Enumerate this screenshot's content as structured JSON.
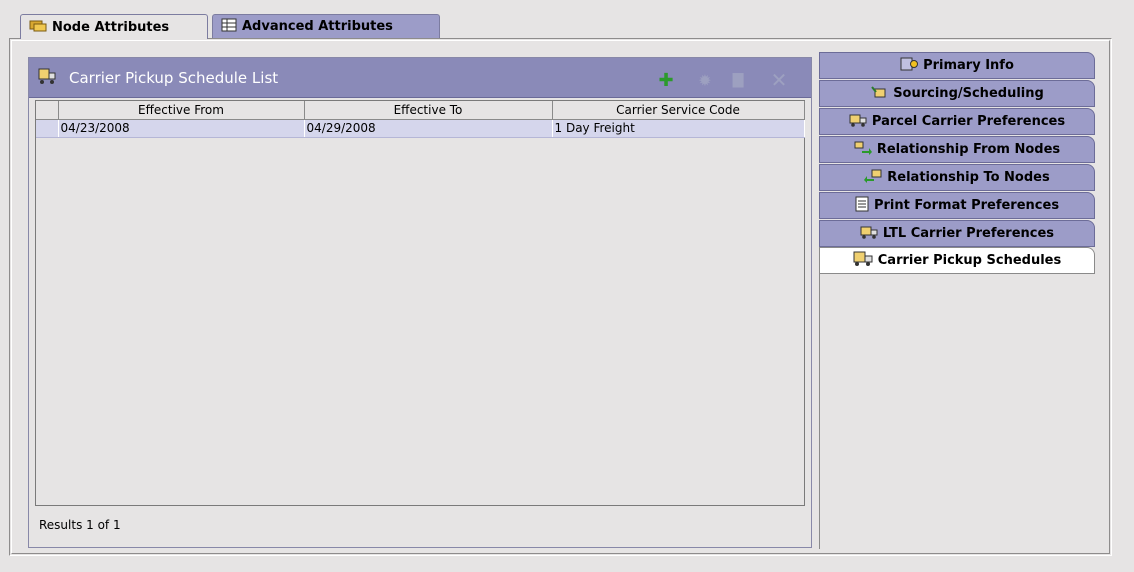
{
  "top_tabs": [
    {
      "label": "Node Attributes",
      "icon": "node-icon",
      "active": true
    },
    {
      "label": "Advanced Attributes",
      "icon": "grid-icon",
      "active": false
    }
  ],
  "panel": {
    "title": "Carrier Pickup Schedule List",
    "icon": "truck-icon",
    "toolbar": {
      "add": "add-icon",
      "details": "gear-icon",
      "save": "save-icon",
      "delete": "delete-icon"
    },
    "columns": [
      "Effective From",
      "Effective To",
      "Carrier Service Code"
    ],
    "rows": [
      {
        "effective_from": "04/23/2008",
        "effective_to": "04/29/2008",
        "carrier_service_code": "1 Day Freight"
      }
    ],
    "results": "Results 1 of 1"
  },
  "side_tabs": [
    {
      "label": "Primary Info",
      "icon": "info-icon"
    },
    {
      "label": "Sourcing/Scheduling",
      "icon": "sourcing-icon"
    },
    {
      "label": "Parcel Carrier Preferences",
      "icon": "truck-icon"
    },
    {
      "label": "Relationship From Nodes",
      "icon": "relationship-from-icon"
    },
    {
      "label": "Relationship To Nodes",
      "icon": "relationship-to-icon"
    },
    {
      "label": "Print Format Preferences",
      "icon": "print-icon"
    },
    {
      "label": "LTL Carrier Preferences",
      "icon": "truck-icon"
    },
    {
      "label": "Carrier Pickup Schedules",
      "icon": "truck-icon",
      "active": true
    }
  ],
  "colors": {
    "header": "#8a8ab8",
    "tab_inactive": "#9c9cc8",
    "row_selected": "#d5d6ec",
    "add": "#2c9a2c"
  }
}
